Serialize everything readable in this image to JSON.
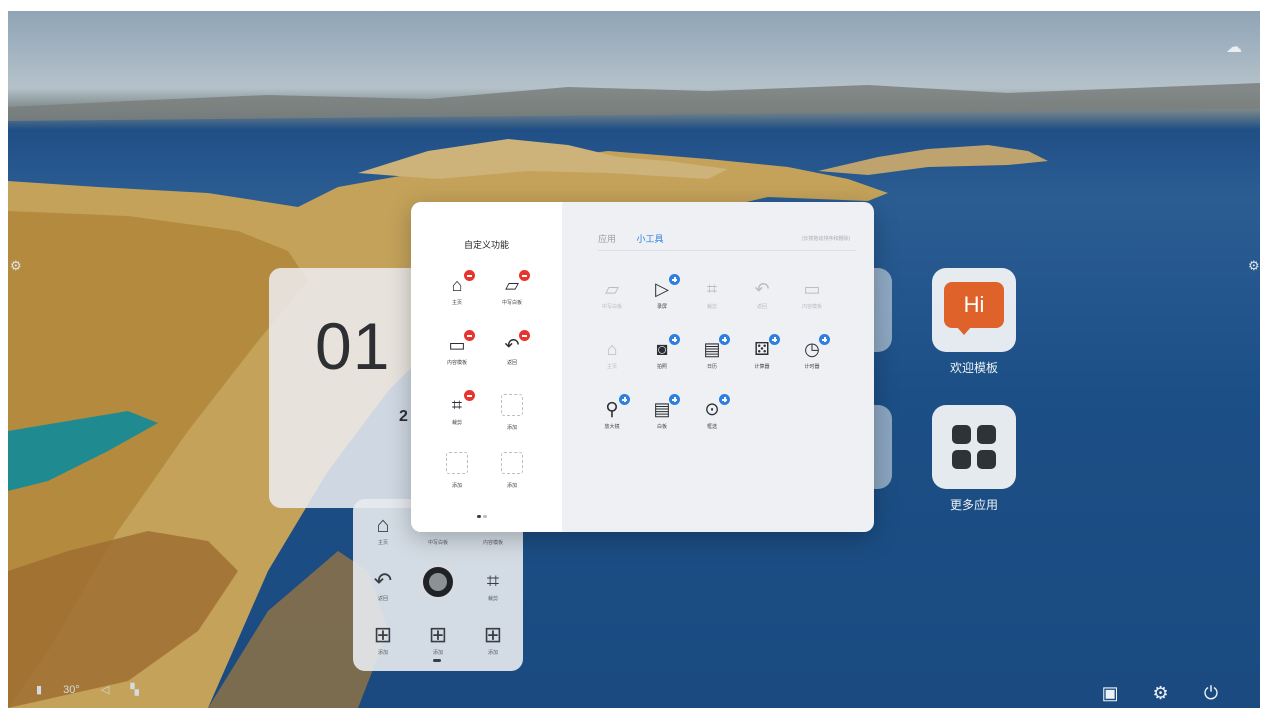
{
  "clock": {
    "time": "01",
    "date": "2"
  },
  "apps": [
    {
      "label": "欢迎模板",
      "icon": "hi-speech-bubble-icon",
      "icon_text": "Hi",
      "color": "#e0622b"
    },
    {
      "label": "更多应用",
      "icon": "app-grid-icon"
    }
  ],
  "side_toolbar": {
    "items": [
      {
        "icon": "home-icon",
        "label": "主页"
      },
      {
        "icon": "annotate-icon",
        "label": "中写白板"
      },
      {
        "icon": "screen-icon",
        "label": "内容模板"
      },
      {
        "icon": "back-icon",
        "label": "返回"
      },
      {
        "icon": "crop-icon",
        "label": "裁剪"
      },
      {
        "icon": "add-icon",
        "label": "添加"
      },
      {
        "icon": "add-icon",
        "label": "添加"
      },
      {
        "icon": "add-icon",
        "label": "添加"
      }
    ]
  },
  "modal": {
    "left_title": "自定义功能",
    "current_items": [
      {
        "icon": "home-icon",
        "label": "主页",
        "state": "remove"
      },
      {
        "icon": "annotate-icon",
        "label": "中写白板",
        "state": "remove"
      },
      {
        "icon": "screen-icon",
        "label": "内容模板",
        "state": "remove"
      },
      {
        "icon": "back-icon",
        "label": "返回",
        "state": "remove"
      },
      {
        "icon": "crop-icon",
        "label": "裁剪",
        "state": "remove"
      },
      {
        "icon": "empty-slot-icon",
        "label": "添加",
        "state": "empty"
      },
      {
        "icon": "empty-slot-icon",
        "label": "添加",
        "state": "empty"
      },
      {
        "icon": "empty-slot-icon",
        "label": "添加",
        "state": "empty"
      }
    ],
    "tabs": [
      {
        "label": "应用",
        "active": false
      },
      {
        "label": "小工具",
        "active": true
      }
    ],
    "hint": "(长按拖动排序和删除)",
    "tool_items": [
      {
        "icon": "annotate-icon",
        "label": "中写白板",
        "state": "disabled"
      },
      {
        "icon": "play-icon",
        "label": "录屏",
        "state": "add"
      },
      {
        "icon": "crop-icon",
        "label": "裁剪",
        "state": "disabled"
      },
      {
        "icon": "back-icon",
        "label": "返回",
        "state": "disabled"
      },
      {
        "icon": "screen-icon",
        "label": "内容模板",
        "state": "disabled"
      },
      {
        "icon": "home-icon",
        "label": "主页",
        "state": "disabled"
      },
      {
        "icon": "camera-icon",
        "label": "拍照",
        "state": "add"
      },
      {
        "icon": "calendar-icon",
        "label": "日历",
        "state": "add"
      },
      {
        "icon": "dice-icon",
        "label": "计算器",
        "state": "add"
      },
      {
        "icon": "clock-icon",
        "label": "计时器",
        "state": "add"
      },
      {
        "icon": "magnifier-icon",
        "label": "放大镜",
        "state": "add"
      },
      {
        "icon": "whiteboard-icon",
        "label": "白板",
        "state": "add"
      },
      {
        "icon": "select-icon",
        "label": "框选",
        "state": "add"
      }
    ]
  },
  "status_bar": {
    "temperature": "30°",
    "icons": [
      "wifi-icon",
      "volume-icon",
      "signal-icon"
    ]
  },
  "bottom_right_icons": [
    "gallery-icon",
    "settings-icon",
    "power-icon"
  ]
}
